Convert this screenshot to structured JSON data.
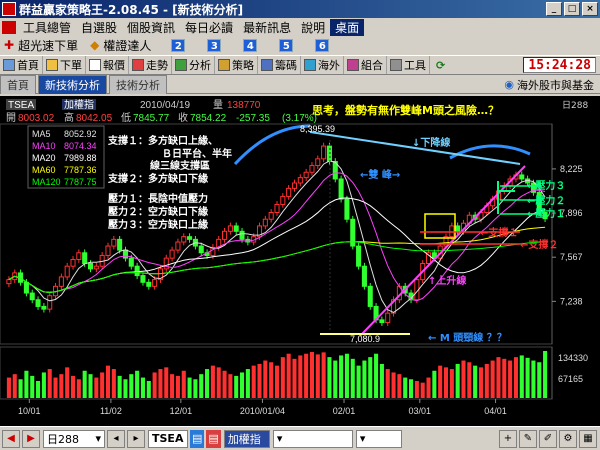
{
  "window": {
    "title": "群益贏家策略王-2.08.45 - [新技術分析]",
    "controls": [
      "_",
      "□",
      "×"
    ]
  },
  "menu": {
    "items": [
      "工具總管",
      "自選股",
      "個股資訊",
      "每日必讀",
      "最新訊息",
      "說明",
      "桌面"
    ],
    "active_index": 6
  },
  "quickbar": {
    "items": [
      "超光速下單",
      "權證達人"
    ],
    "numbers": [
      "2",
      "3",
      "4",
      "5",
      "6"
    ]
  },
  "toolbar": {
    "items": [
      "首頁",
      "下單",
      "報價",
      "走勢",
      "分析",
      "策略",
      "籌碼",
      "海外",
      "組合",
      "工具"
    ],
    "clock": "15:24:28"
  },
  "tabs": {
    "items": [
      "首頁",
      "新技術分析",
      "技術分析"
    ],
    "active_index": 1,
    "right_label": "海外股市與基金"
  },
  "chart_header": {
    "symbol": "TSEA",
    "index_label": "加權指",
    "date": "2010/04/19",
    "volume_label": "量",
    "volume_value": "138770",
    "open_label": "開",
    "open_value": "8003.02",
    "high_label": "高",
    "high_value": "8042.05",
    "low_label": "低",
    "low_value": "7845.77",
    "close_label": "收",
    "close_value": "7854.22",
    "change_value": "-257.35",
    "change_pct": "(3.17%)",
    "period_tag": "日288",
    "annotation_title": "思考，盤勢有無作雙峰M頭之風險…？"
  },
  "ma_legend": [
    {
      "name": "MA5",
      "value": "8052.92",
      "color": "#e0e0e0"
    },
    {
      "name": "MA10",
      "value": "8074.34",
      "color": "#ff40ff"
    },
    {
      "name": "MA20",
      "value": "7989.88",
      "color": "#ffffff"
    },
    {
      "name": "MA60",
      "value": "7787.36",
      "color": "#ffff00"
    },
    {
      "name": "MA120",
      "value": "7787.75",
      "color": "#00ff00"
    }
  ],
  "notes": {
    "support1": "支撐１：多方缺口上緣、",
    "support1b": "Ｂ日平台、半年",
    "support1c": "線三線支撐區",
    "support2": "支撐２：多方缺口下緣",
    "pressure1": "壓力１：長陰中值壓力",
    "pressure2": "壓力２：空方缺口下緣",
    "pressure3": "壓力３：空方缺口上緣",
    "downtrend": "↓下降線",
    "double_peak": "←雙    峰→",
    "uptrend": "↑上升線",
    "neckline": "← M 頭頸線 ？？",
    "right_p3": "←壓力３",
    "right_p2": "←壓力２",
    "right_p1": "←壓力１",
    "right_s1": "←支撐１",
    "right_s2": "←支撐２",
    "peak_label": "8,395.39",
    "low_label": "7,080.9"
  },
  "chart_data": {
    "type": "candlestick",
    "price_axis_ticks": [
      "8,225",
      "7,896",
      "7,567",
      "7,238"
    ],
    "volume_axis_ticks": [
      "134330",
      "67165"
    ],
    "x_ticks": [
      "10/01",
      "11/02",
      "12/01",
      "2010/01/04",
      "02/01",
      "03/01",
      "04/01"
    ],
    "ylim": [
      6950,
      8500
    ],
    "closes": [
      7400,
      7450,
      7380,
      7300,
      7250,
      7200,
      7180,
      7280,
      7350,
      7420,
      7500,
      7550,
      7600,
      7520,
      7480,
      7500,
      7580,
      7650,
      7700,
      7620,
      7560,
      7500,
      7430,
      7380,
      7350,
      7400,
      7480,
      7560,
      7620,
      7680,
      7720,
      7700,
      7650,
      7600,
      7580,
      7640,
      7700,
      7760,
      7800,
      7760,
      7700,
      7680,
      7720,
      7800,
      7850,
      7900,
      7960,
      8020,
      8080,
      8120,
      8160,
      8200,
      8250,
      8300,
      8395,
      8280,
      8150,
      8000,
      7850,
      7650,
      7500,
      7350,
      7200,
      7100,
      7080,
      7150,
      7250,
      7350,
      7300,
      7250,
      7400,
      7520,
      7600,
      7560,
      7650,
      7720,
      7800,
      7760,
      7820,
      7880,
      7850,
      7900,
      7950,
      8000,
      8060,
      8100,
      8150,
      8180,
      8150,
      8120,
      8050,
      7900,
      7854
    ],
    "volumes": [
      60,
      70,
      55,
      80,
      65,
      50,
      75,
      85,
      60,
      70,
      90,
      65,
      55,
      80,
      70,
      60,
      75,
      95,
      85,
      65,
      55,
      70,
      80,
      60,
      50,
      75,
      85,
      90,
      70,
      65,
      80,
      60,
      55,
      70,
      85,
      95,
      90,
      80,
      70,
      65,
      75,
      85,
      95,
      100,
      110,
      105,
      95,
      120,
      130,
      115,
      125,
      130,
      135,
      128,
      134,
      120,
      110,
      125,
      130,
      115,
      95,
      110,
      120,
      130,
      100,
      85,
      75,
      70,
      60,
      55,
      50,
      45,
      60,
      80,
      95,
      90,
      85,
      100,
      110,
      105,
      95,
      90,
      100,
      110,
      120,
      115,
      110,
      120,
      125,
      118,
      110,
      105,
      138
    ]
  }
}
